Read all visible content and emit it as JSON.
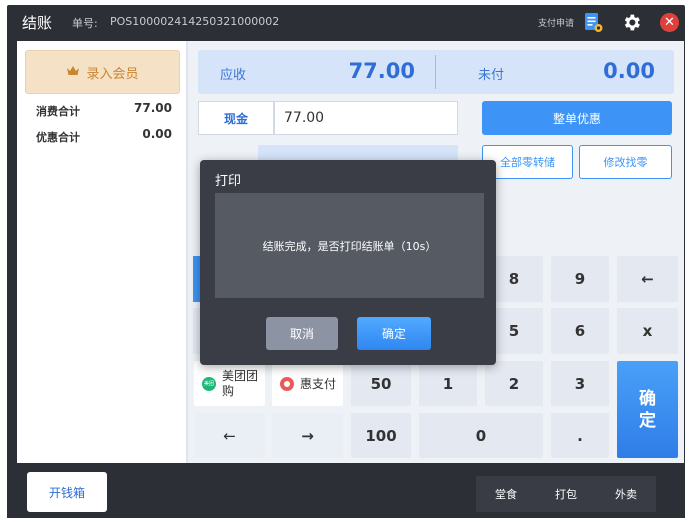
{
  "window": {
    "title": "结账",
    "order_label": "单号:",
    "order_no": "POS100002414250321000002",
    "pay_apply": "支付申请"
  },
  "member": {
    "button_label": "录入会员"
  },
  "summary": {
    "consume_label": "消费合计",
    "consume_value": "77.00",
    "discount_label": "优惠合计",
    "discount_value": "0.00"
  },
  "amounts": {
    "due_label": "应收",
    "due_value": "77.00",
    "unpaid_label": "未付",
    "unpaid_value": "0.00"
  },
  "payment": {
    "cash_label": "现金",
    "cash_value": "77.00"
  },
  "actions": {
    "whole_discount": "整单优惠",
    "all_change_to_store": "全部零转储",
    "modify_change": "修改找零"
  },
  "pay_methods": {
    "meituan": "美团团购",
    "huizhifu": "惠支付",
    "meituan_icon": "美团"
  },
  "keypad": {
    "k8": "8",
    "k9": "9",
    "backspace": "←",
    "k5": "5",
    "k6": "6",
    "clear": "x",
    "k50": "50",
    "k1": "1",
    "k2": "2",
    "k3": "3",
    "left": "←",
    "right": "→",
    "k100": "100",
    "k0": "0",
    "dot": ".",
    "confirm": "确定"
  },
  "bottom": {
    "drawer": "开钱箱",
    "dine_in": "堂食",
    "package": "打包",
    "takeout": "外卖"
  },
  "dialog": {
    "title": "打印",
    "message": "结账完成，是否打印结账单（10s）",
    "cancel": "取消",
    "ok": "确定"
  },
  "colors": {
    "accent": "#3d94f6",
    "dark": "#2d2f36",
    "gold": "#c98530",
    "close": "#e0403b"
  }
}
